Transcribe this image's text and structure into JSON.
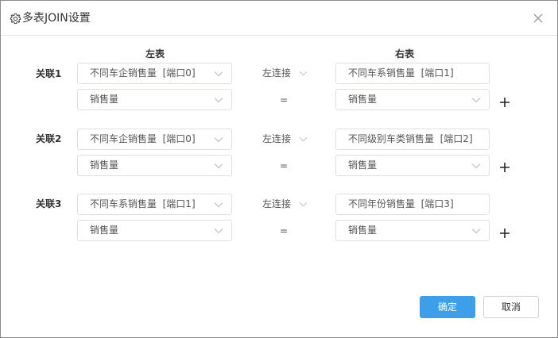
{
  "dialog": {
    "title": "多表JOIN设置",
    "left_header": "左表",
    "right_header": "右表"
  },
  "relations": [
    {
      "label": "关联1",
      "left_table": "不同车企销售量  [端口0]",
      "join_type": "左连接",
      "right_table": "不同车系销售量  [端口1]",
      "left_field": "销售量",
      "operator": "=",
      "right_field": "销售量"
    },
    {
      "label": "关联2",
      "left_table": "不同车企销售量  [端口0]",
      "join_type": "左连接",
      "right_table": "不同级别车类销售量  [端口2]",
      "left_field": "销售量",
      "operator": "=",
      "right_field": "销售量"
    },
    {
      "label": "关联3",
      "left_table": "不同车系销售量  [端口1]",
      "join_type": "左连接",
      "right_table": "不同年份销售量  [端口3]",
      "left_field": "销售量",
      "operator": "=",
      "right_field": "销售量"
    }
  ],
  "footer": {
    "ok_label": "确定",
    "cancel_label": "取消"
  },
  "colors": {
    "primary": "#3d9eea",
    "border": "#dcdfe6",
    "text": "#333333"
  },
  "icons": {
    "title": "gear-icon",
    "close": "close-icon",
    "add": "plus-icon",
    "dropdown": "chevron-down-icon"
  }
}
